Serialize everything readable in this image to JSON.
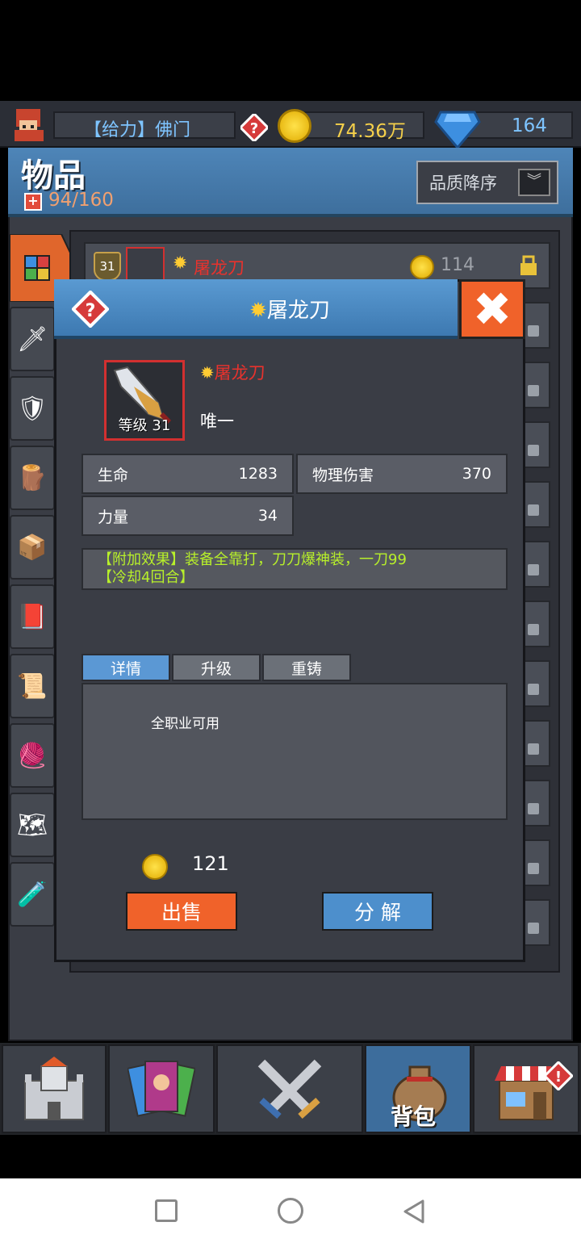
{
  "topbar": {
    "player_name": "【给力】佛门",
    "gold": "74.36万",
    "gems": "164"
  },
  "header": {
    "title": "物品",
    "capacity": "94/160",
    "sort_button": "品质降序"
  },
  "list": {
    "first_item": {
      "level": "31",
      "name": "屠龙刀",
      "price": "114"
    }
  },
  "modal": {
    "title": "屠龙刀",
    "item_name": "屠龙刀",
    "item_level_label": "等级 31",
    "rarity": "唯一",
    "stats": [
      {
        "label": "生命",
        "value": "1283"
      },
      {
        "label": "物理伤害",
        "value": "370"
      },
      {
        "label": "力量",
        "value": "34"
      }
    ],
    "effect_line1": "【附加效果】装备全靠打，刀刀爆神装，一刀99",
    "effect_line2": "【冷却4回合】",
    "tabs": [
      "详情",
      "升级",
      "重铸"
    ],
    "details_text": "全职业可用",
    "sell_price": "121",
    "sell_button": "出售",
    "decompose_button": "分 解"
  },
  "bottom_nav": {
    "bag_label": "背包"
  },
  "colors": {
    "accent_orange": "#f0622a",
    "accent_blue": "#4d8fcc",
    "item_name_red": "#e8322d",
    "effect_green": "#b8f02a"
  }
}
